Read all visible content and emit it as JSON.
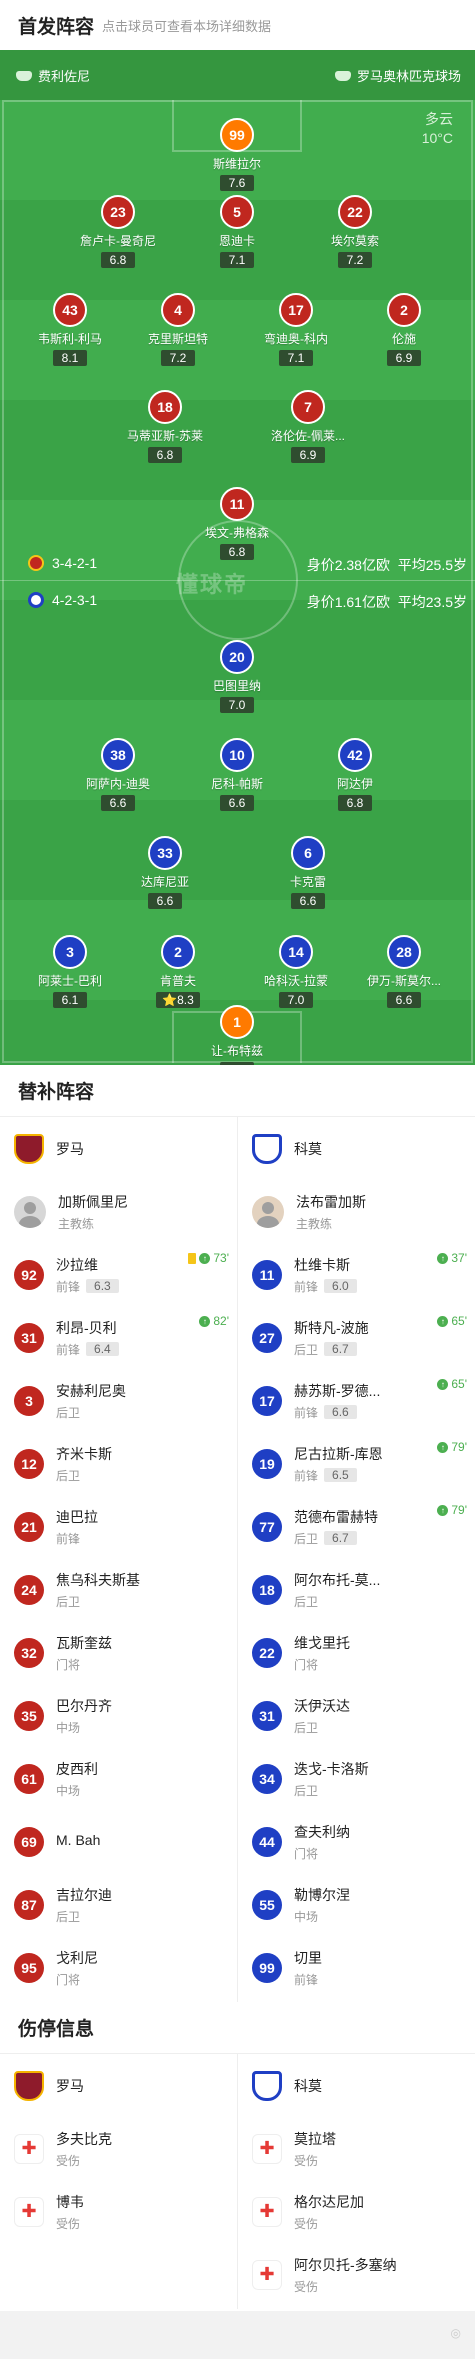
{
  "header": {
    "title": "首发阵容",
    "subtitle": "点击球员可查看本场详细数据"
  },
  "teams": {
    "home": "费利佐尼",
    "away": "罗马奥林匹克球场"
  },
  "weather": {
    "condition": "多云",
    "temp": "10°C"
  },
  "colors": {
    "pitch": "#3aa347",
    "home": "#c0271f",
    "away": "#1f3fc4",
    "gk_home": "#ff7a00",
    "rating_bg": "#2f4d2f"
  },
  "formations": {
    "home": {
      "shape": "3-4-2-1",
      "value": "身价2.38亿欧",
      "avg_age": "平均25.5岁"
    },
    "away": {
      "shape": "4-2-3-1",
      "value": "身价1.61亿欧",
      "avg_age": "平均23.5岁"
    }
  },
  "pitch_logo": "懂球帝",
  "home_players": [
    {
      "num": "99",
      "name": "斯维拉尔",
      "rating": "7.6",
      "gk": true
    },
    {
      "num": "23",
      "name": "詹卢卡-曼奇尼",
      "rating": "6.8",
      "yellow": true
    },
    {
      "num": "5",
      "name": "恩迪卡",
      "rating": "7.1"
    },
    {
      "num": "22",
      "name": "埃尔莫索",
      "rating": "7.2"
    },
    {
      "num": "43",
      "name": "韦斯利-利马",
      "rating": "8.1",
      "yellow": true,
      "goal": true
    },
    {
      "num": "4",
      "name": "克里斯坦特",
      "rating": "7.2",
      "captain": true
    },
    {
      "num": "17",
      "name": "弯迪奥-科内",
      "rating": "7.1"
    },
    {
      "num": "2",
      "name": "伦施",
      "rating": "6.9"
    },
    {
      "num": "18",
      "name": "马蒂亚斯-苏莱",
      "rating": "6.8",
      "sub_off": "82'",
      "goal": true
    },
    {
      "num": "7",
      "name": "洛伦佐-佩莱...",
      "rating": "6.9",
      "sub_off": "73'"
    },
    {
      "num": "11",
      "name": "埃文-弗格森",
      "rating": "6.8"
    }
  ],
  "away_players": [
    {
      "num": "20",
      "name": "巴图里纳",
      "rating": "7.0",
      "sub_off": "79'"
    },
    {
      "num": "38",
      "name": "阿萨内-迪奥",
      "rating": "6.6",
      "sub_off": "37'"
    },
    {
      "num": "10",
      "name": "尼科-帕斯",
      "rating": "6.6",
      "yellow": true
    },
    {
      "num": "42",
      "name": "阿达伊",
      "rating": "6.8",
      "yellow": true,
      "sub_off": "65'"
    },
    {
      "num": "33",
      "name": "达库尼亚",
      "rating": "6.6",
      "captain": true
    },
    {
      "num": "6",
      "name": "卡克雷",
      "rating": "6.6",
      "sub_off": "65'"
    },
    {
      "num": "3",
      "name": "阿莱士-巴利",
      "rating": "6.1"
    },
    {
      "num": "2",
      "name": "肯普夫",
      "rating": "8.3",
      "star": "⭐"
    },
    {
      "num": "14",
      "name": "哈科沃-拉蒙",
      "rating": "7.0",
      "yellow": true
    },
    {
      "num": "28",
      "name": "伊万-斯莫尔...",
      "rating": "6.6",
      "sub_off": "79'"
    },
    {
      "num": "1",
      "name": "让-布特兹",
      "rating": "6.9",
      "gk": true
    }
  ],
  "subs": {
    "title": "替补阵容",
    "home_team": "罗马",
    "away_team": "科莫",
    "home_coach": {
      "name": "加斯佩里尼",
      "role": "主教练"
    },
    "away_coach": {
      "name": "法布雷加斯",
      "role": "主教练"
    },
    "home": [
      {
        "num": "92",
        "name": "沙拉维",
        "pos": "前锋",
        "rating": "6.3",
        "sub_in": "73'",
        "yellow": true
      },
      {
        "num": "31",
        "name": "利昂-贝利",
        "pos": "前锋",
        "rating": "6.4",
        "sub_in": "82'"
      },
      {
        "num": "3",
        "name": "安赫利尼奥",
        "pos": "后卫"
      },
      {
        "num": "12",
        "name": "齐米卡斯",
        "pos": "后卫"
      },
      {
        "num": "21",
        "name": "迪巴拉",
        "pos": "前锋"
      },
      {
        "num": "24",
        "name": "焦乌科夫斯基",
        "pos": "后卫"
      },
      {
        "num": "32",
        "name": "瓦斯奎兹",
        "pos": "门将"
      },
      {
        "num": "35",
        "name": "巴尔丹齐",
        "pos": "中场"
      },
      {
        "num": "61",
        "name": "皮西利",
        "pos": "中场"
      },
      {
        "num": "69",
        "name": "M. Bah",
        "pos": ""
      },
      {
        "num": "87",
        "name": "吉拉尔迪",
        "pos": "后卫"
      },
      {
        "num": "95",
        "name": "戈利尼",
        "pos": "门将"
      }
    ],
    "away": [
      {
        "num": "11",
        "name": "杜维卡斯",
        "pos": "前锋",
        "rating": "6.0",
        "sub_in": "37'"
      },
      {
        "num": "27",
        "name": "斯特凡-波施",
        "pos": "后卫",
        "rating": "6.7",
        "sub_in": "65'"
      },
      {
        "num": "17",
        "name": "赫苏斯-罗德...",
        "pos": "前锋",
        "rating": "6.6",
        "sub_in": "65'"
      },
      {
        "num": "19",
        "name": "尼古拉斯-库恩",
        "pos": "前锋",
        "rating": "6.5",
        "sub_in": "79'"
      },
      {
        "num": "77",
        "name": "范德布雷赫特",
        "pos": "后卫",
        "rating": "6.7",
        "sub_in": "79'"
      },
      {
        "num": "18",
        "name": "阿尔布托-莫...",
        "pos": "后卫"
      },
      {
        "num": "22",
        "name": "维戈里托",
        "pos": "门将"
      },
      {
        "num": "31",
        "name": "沃伊沃达",
        "pos": "后卫"
      },
      {
        "num": "34",
        "name": "迭戈-卡洛斯",
        "pos": "后卫"
      },
      {
        "num": "44",
        "name": "查夫利纳",
        "pos": "门将"
      },
      {
        "num": "55",
        "name": "勒博尔涅",
        "pos": "中场"
      },
      {
        "num": "99",
        "name": "切里",
        "pos": "前锋"
      }
    ]
  },
  "injuries": {
    "title": "伤停信息",
    "home_team": "罗马",
    "away_team": "科莫",
    "home": [
      {
        "name": "多夫比克",
        "status": "受伤"
      },
      {
        "name": "博韦",
        "status": "受伤"
      }
    ],
    "away": [
      {
        "name": "莫拉塔",
        "status": "受伤"
      },
      {
        "name": "格尔达尼加",
        "status": "受伤"
      },
      {
        "name": "阿尔贝托-多塞纳",
        "status": "受伤"
      }
    ]
  }
}
